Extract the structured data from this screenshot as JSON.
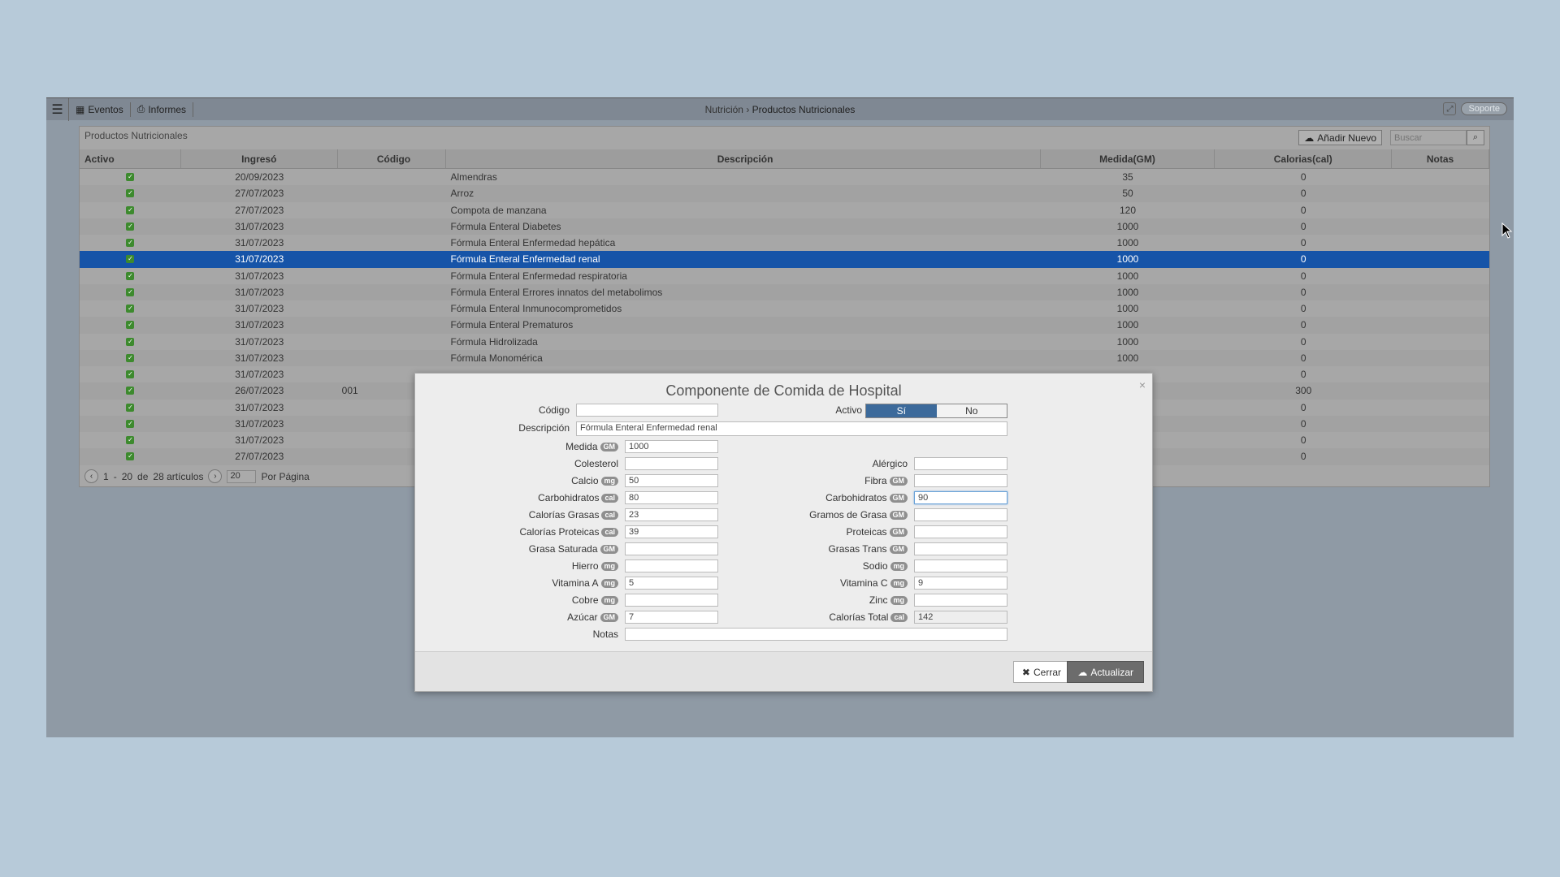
{
  "topbar": {
    "events_label": "Eventos",
    "reports_label": "Informes",
    "breadcrumb_parent": "Nutrición",
    "breadcrumb_sep": "›",
    "breadcrumb_current": "Productos Nutricionales",
    "support_label": "Soporte"
  },
  "panel": {
    "title": "Productos Nutricionales",
    "add_label": "Añadir Nuevo",
    "search_placeholder": "Buscar",
    "columns": [
      "Activo",
      "Ingresó",
      "Código",
      "Descripción",
      "Medida(GM)",
      "Calorias(cal)",
      "Notas"
    ],
    "rows": [
      {
        "date": "20/09/2023",
        "code": "",
        "desc": "Almendras",
        "measure": "35",
        "cal": "0",
        "notes": ""
      },
      {
        "date": "27/07/2023",
        "code": "",
        "desc": "Arroz",
        "measure": "50",
        "cal": "0",
        "notes": ""
      },
      {
        "date": "27/07/2023",
        "code": "",
        "desc": "Compota de manzana",
        "measure": "120",
        "cal": "0",
        "notes": ""
      },
      {
        "date": "31/07/2023",
        "code": "",
        "desc": "Fórmula Enteral Diabetes",
        "measure": "1000",
        "cal": "0",
        "notes": ""
      },
      {
        "date": "31/07/2023",
        "code": "",
        "desc": "Fórmula Enteral Enfermedad hepática",
        "measure": "1000",
        "cal": "0",
        "notes": ""
      },
      {
        "date": "31/07/2023",
        "code": "",
        "desc": "Fórmula Enteral Enfermedad renal",
        "measure": "1000",
        "cal": "0",
        "notes": "",
        "selected": true
      },
      {
        "date": "31/07/2023",
        "code": "",
        "desc": "Fórmula Enteral Enfermedad respiratoria",
        "measure": "1000",
        "cal": "0",
        "notes": ""
      },
      {
        "date": "31/07/2023",
        "code": "",
        "desc": "Fórmula Enteral Errores innatos del metabolimos",
        "measure": "1000",
        "cal": "0",
        "notes": ""
      },
      {
        "date": "31/07/2023",
        "code": "",
        "desc": "Fórmula Enteral Inmunocomprometidos",
        "measure": "1000",
        "cal": "0",
        "notes": ""
      },
      {
        "date": "31/07/2023",
        "code": "",
        "desc": "Fórmula Enteral Prematuros",
        "measure": "1000",
        "cal": "0",
        "notes": ""
      },
      {
        "date": "31/07/2023",
        "code": "",
        "desc": "Fórmula Hidrolizada",
        "measure": "1000",
        "cal": "0",
        "notes": ""
      },
      {
        "date": "31/07/2023",
        "code": "",
        "desc": "Fórmula Monomérica",
        "measure": "1000",
        "cal": "0",
        "notes": ""
      },
      {
        "date": "31/07/2023",
        "code": "",
        "desc": "",
        "measure": "",
        "cal": "0",
        "notes": ""
      },
      {
        "date": "26/07/2023",
        "code": "001",
        "desc": "",
        "measure": "",
        "cal": "300",
        "notes": ""
      },
      {
        "date": "31/07/2023",
        "code": "",
        "desc": "",
        "measure": "",
        "cal": "0",
        "notes": ""
      },
      {
        "date": "31/07/2023",
        "code": "",
        "desc": "",
        "measure": "",
        "cal": "0",
        "notes": ""
      },
      {
        "date": "31/07/2023",
        "code": "",
        "desc": "",
        "measure": "",
        "cal": "0",
        "notes": ""
      },
      {
        "date": "27/07/2023",
        "code": "",
        "desc": "",
        "measure": "",
        "cal": "0",
        "notes": ""
      }
    ],
    "pager": {
      "from": "1",
      "dash": "-",
      "to": "20",
      "of": "de",
      "total": "28 artículos",
      "page_size": "20",
      "per_page": "Por Página"
    }
  },
  "modal": {
    "title": "Componente de Comida de Hospital",
    "close_x": "×",
    "codigo_label": "Código",
    "codigo_value": "",
    "activo_label": "Activo",
    "yes_label": "Sí",
    "no_label": "No",
    "descripcion_label": "Descripción",
    "descripcion_value": "Fórmula Enteral Enfermedad renal",
    "medida_label": "Medida",
    "medida_value": "1000",
    "colesterol_label": "Colesterol",
    "colesterol_value": "",
    "alergico_label": "Alérgico",
    "alergico_value": "",
    "calcio_label": "Calcio",
    "calcio_value": "50",
    "fibra_label": "Fibra",
    "fibra_value": "",
    "carb_cal_label": "Carbohidratos",
    "carb_cal_value": "80",
    "carb_gm_label": "Carbohidratos",
    "carb_gm_value": "90",
    "cal_grasas_label": "Calorías Grasas",
    "cal_grasas_value": "23",
    "gramos_grasa_label": "Gramos de Grasa",
    "gramos_grasa_value": "",
    "cal_prot_label": "Calorías Proteicas",
    "cal_prot_value": "39",
    "proteicas_label": "Proteicas",
    "proteicas_value": "",
    "grasa_sat_label": "Grasa Saturada",
    "grasa_sat_value": "",
    "grasas_trans_label": "Grasas Trans",
    "grasas_trans_value": "",
    "hierro_label": "Hierro",
    "hierro_value": "",
    "sodio_label": "Sodio",
    "sodio_value": "",
    "vit_a_label": "Vitamina A",
    "vit_a_value": "5",
    "vit_c_label": "Vitamina C",
    "vit_c_value": "9",
    "cobre_label": "Cobre",
    "cobre_value": "",
    "zinc_label": "Zinc",
    "zinc_value": "",
    "azucar_label": "Azúcar",
    "azucar_value": "7",
    "cal_total_label": "Calorías Total",
    "cal_total_value": "142",
    "notas_label": "Notas",
    "notas_value": "",
    "units": {
      "gm": "GM",
      "mg": "mg",
      "cal": "cal"
    },
    "cerrar_label": "Cerrar",
    "actualizar_label": "Actualizar"
  },
  "colors": {
    "selected_row": "#1654a8",
    "active_toggle": "#3c6a9b",
    "check": "#3d8a2e"
  }
}
